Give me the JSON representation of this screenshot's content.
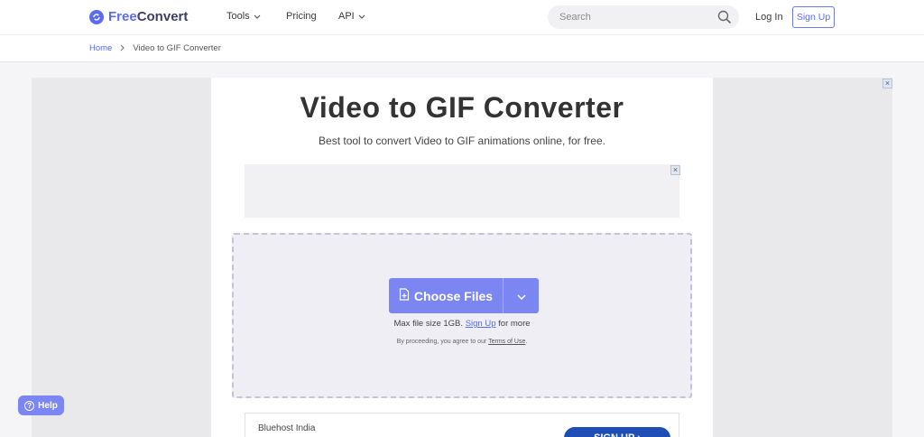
{
  "brand": {
    "free": "Free",
    "convert": "Convert",
    "accent": "#5b6bf2"
  },
  "nav": {
    "tools": "Tools",
    "pricing": "Pricing",
    "api": "API"
  },
  "search": {
    "placeholder": "Search"
  },
  "auth": {
    "login": "Log In",
    "signup": "Sign Up"
  },
  "breadcrumb": {
    "home": "Home",
    "current": "Video to GIF Converter"
  },
  "page": {
    "title": "Video to GIF Converter",
    "subtitle": "Best tool to convert Video to GIF animations online, for free."
  },
  "upload": {
    "button": "Choose Files",
    "max_prefix": "Max file size 1GB.",
    "max_link": "Sign Up",
    "max_suffix": "for more",
    "terms_prefix": "By proceeding, you agree to our",
    "terms_link": "Terms of Use",
    "terms_suffix": "."
  },
  "ads": {
    "close": "×",
    "bottom_name": "Bluehost India",
    "bottom_button": "SIGN UP ›"
  },
  "help": {
    "label": "Help"
  },
  "icons": [
    "logo-icon",
    "chevron-down-icon",
    "search-icon",
    "chevron-right-icon",
    "file-plus-icon",
    "close-icon",
    "help-icon"
  ]
}
